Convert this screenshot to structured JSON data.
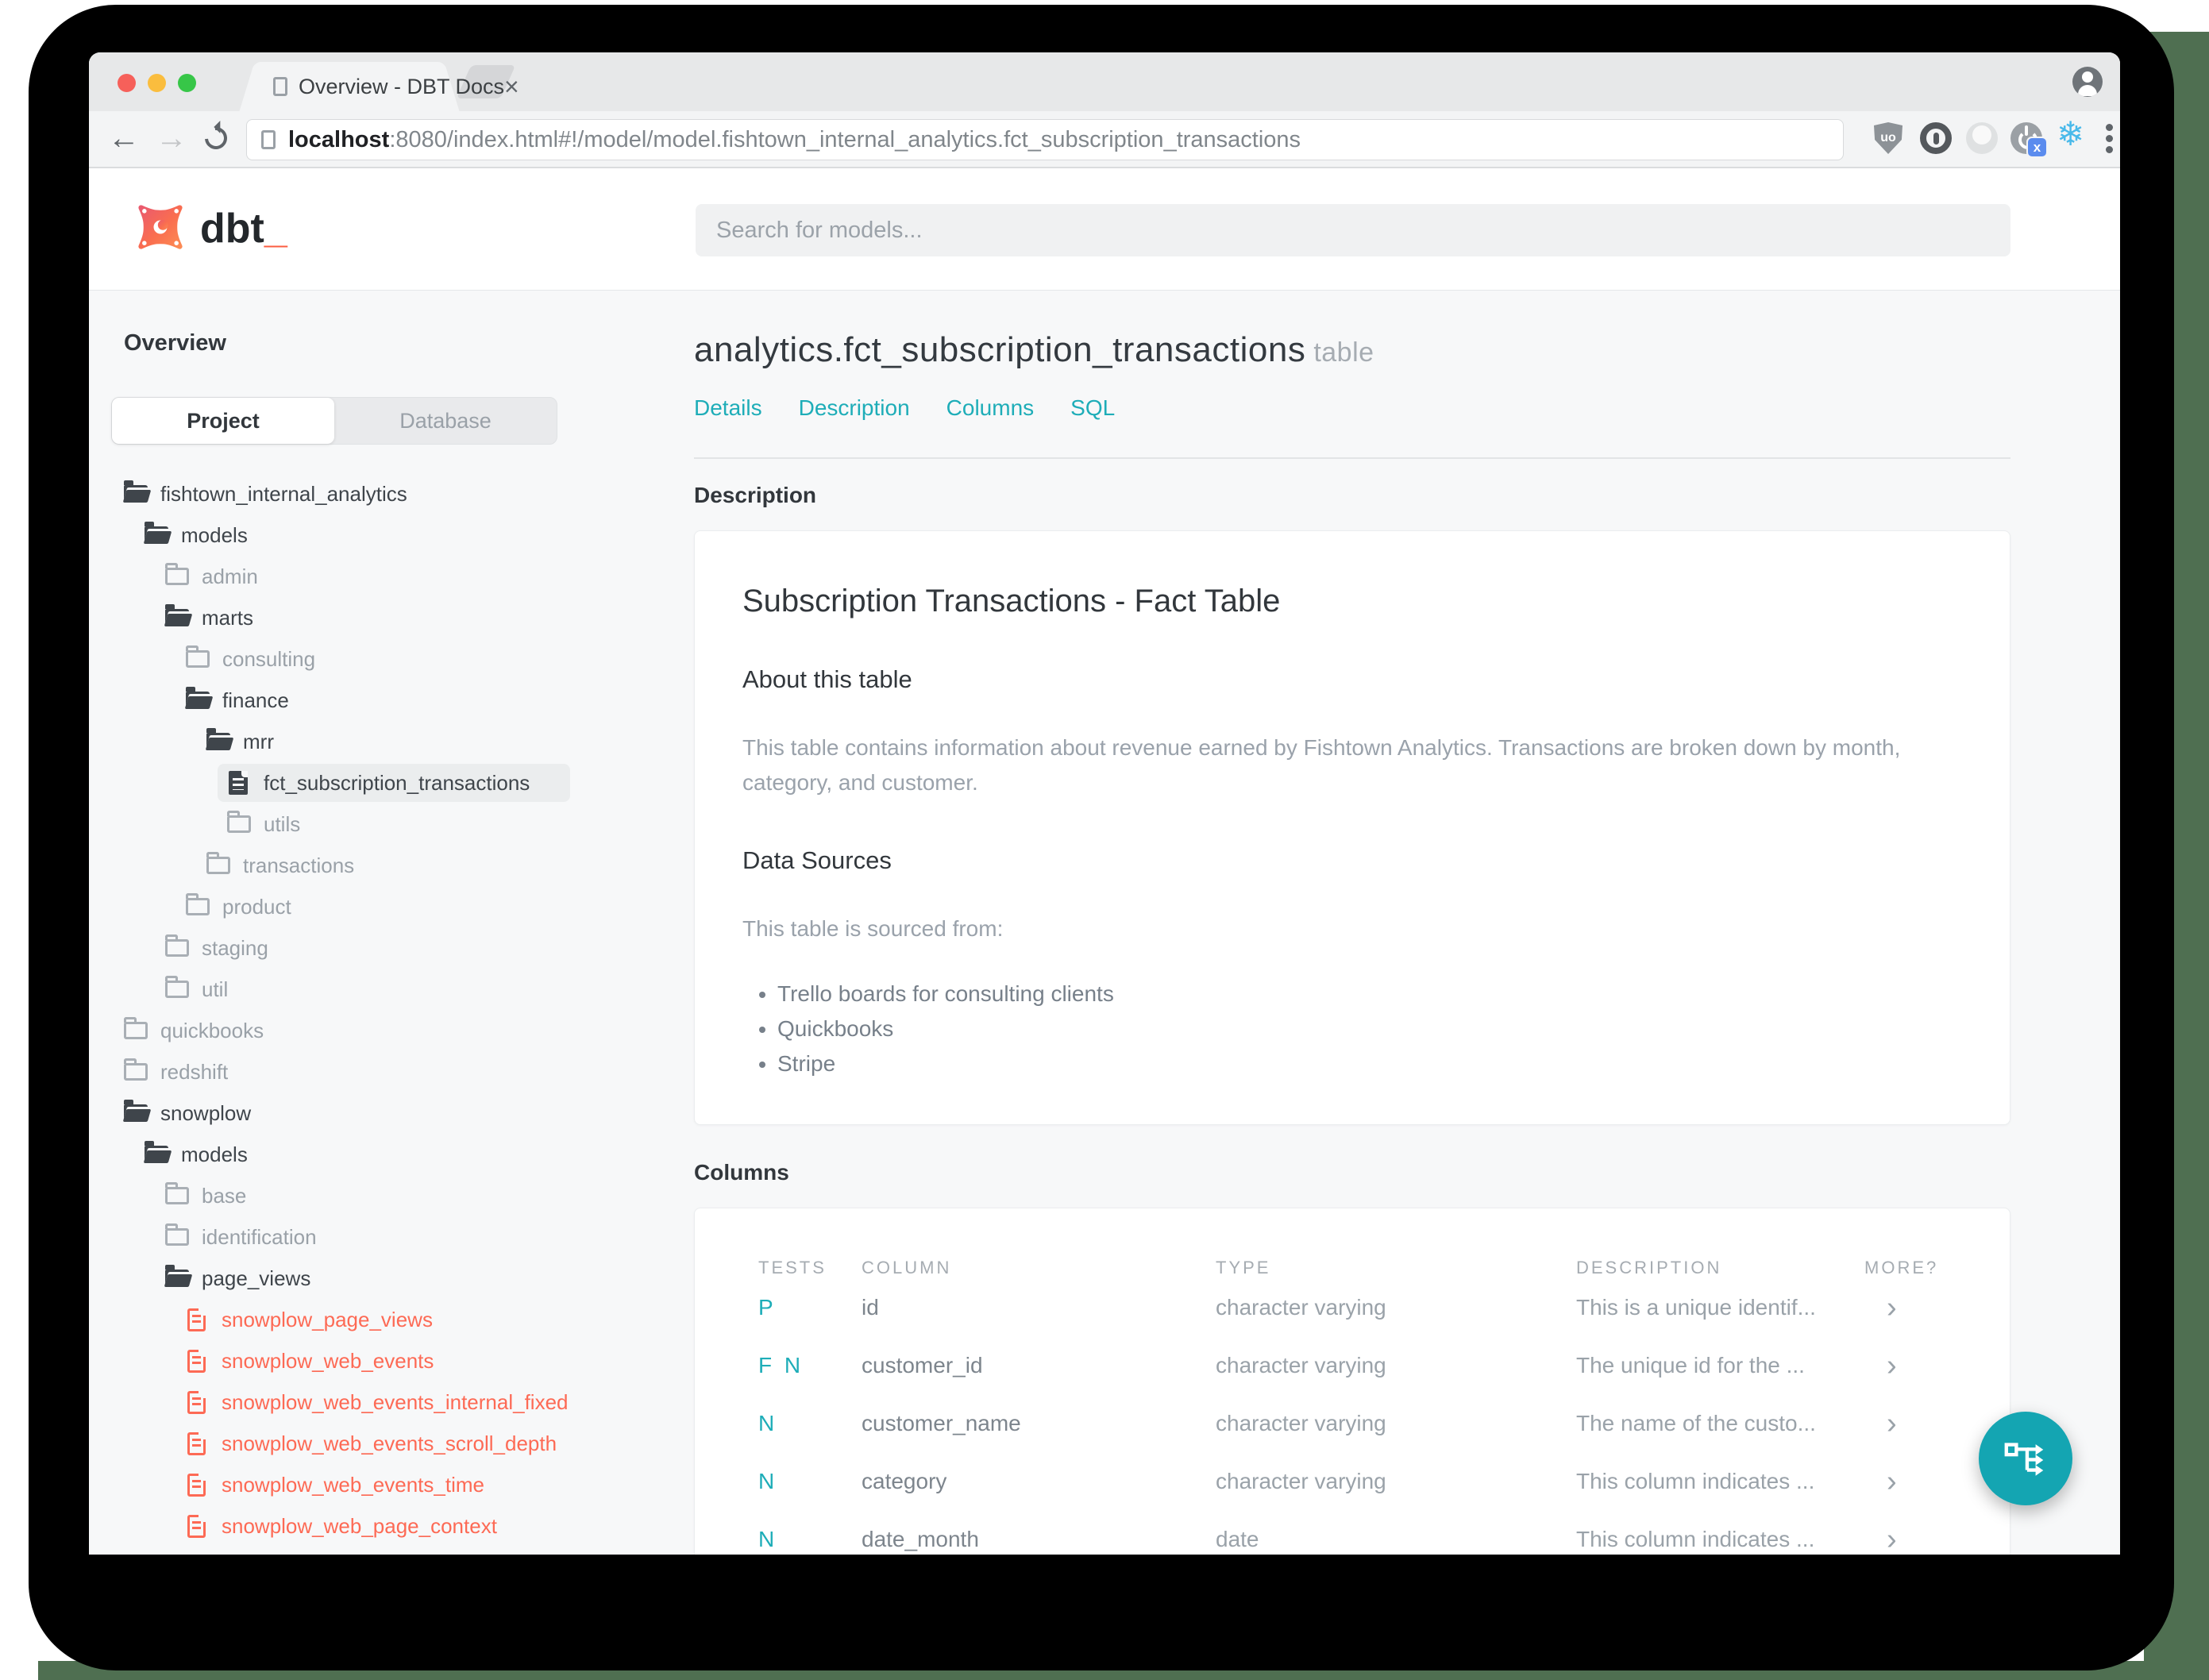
{
  "browser": {
    "tab_title": "Overview - DBT Docs",
    "tab_close": "×",
    "url_host": "localhost",
    "url_rest": ":8080/index.html#!/model/model.fishtown_internal_analytics.fct_subscription_transactions",
    "ublock_label": "uo",
    "power_badge": "x",
    "snowflake_glyph": "❄",
    "extension_icons": [
      "ublock-shield-icon",
      "onepassword-icon",
      "faded-circle-icon",
      "power-x-icon",
      "snowflake-icon",
      "overflow-menu-icon"
    ]
  },
  "header": {
    "logo_word": "dbt",
    "logo_underscore": "_",
    "search_placeholder": "Search for models..."
  },
  "sidebar": {
    "title": "Overview",
    "tabs": [
      {
        "label": "Project"
      },
      {
        "label": "Database"
      }
    ],
    "tree": [
      {
        "label": "fishtown_internal_analytics",
        "level": "0",
        "kind": "folder-open",
        "color": "dark",
        "icon": "folder-open-icon"
      },
      {
        "label": "models",
        "level": "1",
        "kind": "folder-open",
        "color": "dark",
        "icon": "folder-open-icon"
      },
      {
        "label": "admin",
        "level": "2",
        "kind": "folder-closed",
        "color": "gray",
        "icon": "folder-closed-icon"
      },
      {
        "label": "marts",
        "level": "2",
        "kind": "folder-open",
        "color": "dark",
        "icon": "folder-open-icon"
      },
      {
        "label": "consulting",
        "level": "3",
        "kind": "folder-closed",
        "color": "gray",
        "icon": "folder-closed-icon"
      },
      {
        "label": "finance",
        "level": "3",
        "kind": "folder-open",
        "color": "dark",
        "icon": "folder-open-icon"
      },
      {
        "label": "mrr",
        "level": "4",
        "kind": "folder-open",
        "color": "dark",
        "icon": "folder-open-icon"
      },
      {
        "label": "fct_subscription_transactions",
        "level": "5",
        "kind": "file",
        "color": "dark",
        "icon": "model-file-icon",
        "selected": "true"
      },
      {
        "label": "utils",
        "level": "5",
        "kind": "folder-closed",
        "color": "gray",
        "icon": "folder-closed-icon"
      },
      {
        "label": "transactions",
        "level": "4",
        "kind": "folder-closed",
        "color": "gray",
        "icon": "folder-closed-icon"
      },
      {
        "label": "product",
        "level": "3",
        "kind": "folder-closed",
        "color": "gray",
        "icon": "folder-closed-icon"
      },
      {
        "label": "staging",
        "level": "2",
        "kind": "folder-closed",
        "color": "gray",
        "icon": "folder-closed-icon"
      },
      {
        "label": "util",
        "level": "2",
        "kind": "folder-closed",
        "color": "gray",
        "icon": "folder-closed-icon"
      },
      {
        "label": "quickbooks",
        "level": "0",
        "kind": "folder-closed",
        "color": "gray",
        "icon": "folder-closed-icon"
      },
      {
        "label": "redshift",
        "level": "0",
        "kind": "folder-closed",
        "color": "gray",
        "icon": "folder-closed-icon"
      },
      {
        "label": "snowplow",
        "level": "0",
        "kind": "folder-open",
        "color": "dark",
        "icon": "folder-open-icon"
      },
      {
        "label": "models",
        "level": "1",
        "kind": "folder-open",
        "color": "dark",
        "icon": "folder-open-icon"
      },
      {
        "label": "base",
        "level": "2",
        "kind": "folder-closed",
        "color": "gray",
        "icon": "folder-closed-icon"
      },
      {
        "label": "identification",
        "level": "2",
        "kind": "folder-closed",
        "color": "gray",
        "icon": "folder-closed-icon"
      },
      {
        "label": "page_views",
        "level": "2",
        "kind": "folder-open",
        "color": "dark",
        "icon": "folder-open-icon"
      },
      {
        "label": "snowplow_page_views",
        "level": "3",
        "kind": "file",
        "color": "red",
        "icon": "model-file-icon"
      },
      {
        "label": "snowplow_web_events",
        "level": "3",
        "kind": "file",
        "color": "red",
        "icon": "model-file-icon"
      },
      {
        "label": "snowplow_web_events_internal_fixed",
        "level": "3",
        "kind": "file",
        "color": "red",
        "icon": "model-file-icon"
      },
      {
        "label": "snowplow_web_events_scroll_depth",
        "level": "3",
        "kind": "file",
        "color": "red",
        "icon": "model-file-icon"
      },
      {
        "label": "snowplow_web_events_time",
        "level": "3",
        "kind": "file",
        "color": "red",
        "icon": "model-file-icon"
      },
      {
        "label": "snowplow_web_page_context",
        "level": "3",
        "kind": "file",
        "color": "red",
        "icon": "model-file-icon"
      }
    ]
  },
  "main": {
    "title": "analytics.fct_subscription_transactions",
    "title_suffix": "table",
    "nav": [
      "Details",
      "Description",
      "Columns",
      "SQL"
    ],
    "description_heading": "Description",
    "card": {
      "title": "Subscription Transactions - Fact Table",
      "about_heading": "About this table",
      "about_text": "This table contains information about revenue earned by Fishtown Analytics. Transactions are broken down by month, category, and customer.",
      "sources_heading": "Data Sources",
      "sources_intro": "This table is sourced from:",
      "sources": [
        "Trello boards for consulting clients",
        "Quickbooks",
        "Stripe"
      ]
    },
    "columns_heading": "Columns",
    "table": {
      "headers": [
        "TESTS",
        "COLUMN",
        "TYPE",
        "DESCRIPTION",
        "MORE?"
      ],
      "rows": [
        {
          "tests": "P",
          "column": "id",
          "type": "character varying",
          "description": "This is a unique identif...",
          "more": "›"
        },
        {
          "tests": "F N",
          "column": "customer_id",
          "type": "character varying",
          "description": "The unique id for the ...",
          "more": "›"
        },
        {
          "tests": "N",
          "column": "customer_name",
          "type": "character varying",
          "description": "The name of the custo...",
          "more": "›"
        },
        {
          "tests": "N",
          "column": "category",
          "type": "character varying",
          "description": "This column indicates ...",
          "more": "›"
        },
        {
          "tests": "N",
          "column": "date_month",
          "type": "date",
          "description": "This column indicates ...",
          "more": "›"
        }
      ]
    }
  },
  "fab": {
    "icon": "lineage-graph-icon"
  },
  "colors": {
    "accent_teal": "#1eadb8",
    "brand_orange": "#fb5d41",
    "error_red": "#fd6a55"
  }
}
